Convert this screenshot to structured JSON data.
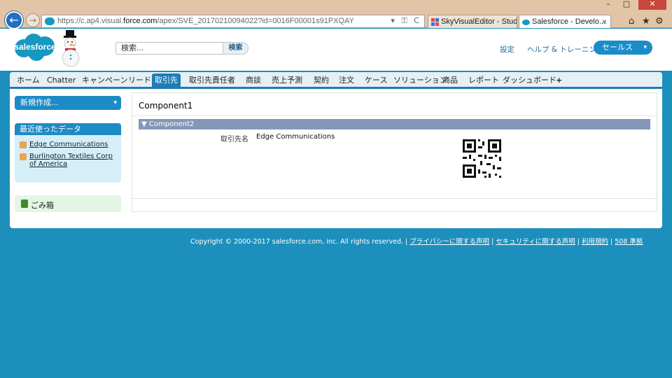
{
  "browser": {
    "url_prefix": "https://c.ap4.visual.",
    "url_domain": "force.com",
    "url_path": "/apex/SVE_20170210094022?id=0016F00001s91PXQAY",
    "address_tools": "▾ ⚿ C",
    "tabs": [
      {
        "label": "SkyVisualEditor - Studio"
      },
      {
        "label": "Salesforce - Develo..."
      }
    ],
    "tab_close": "×",
    "window_controls": {
      "minimize": "–",
      "maximize": "□",
      "close": "✕"
    },
    "toolbar_icons": {
      "home": "⌂",
      "favorites": "★",
      "settings": "⚙"
    },
    "back_glyph": "←",
    "forward_glyph": "→"
  },
  "header": {
    "logo_text": "salesforce",
    "search_placeholder": "検索...",
    "search_button": "検索",
    "links": {
      "settings": "設定",
      "help": "ヘルプ & トレーニング"
    },
    "app_menu": "セールス",
    "caret": "▾"
  },
  "nav": {
    "tabs": [
      "ホーム",
      "Chatter",
      "キャンペーン",
      "リード",
      "取引先",
      "取引先責任者",
      "商談",
      "売上予測",
      "契約",
      "注文",
      "ケース",
      "ソリューション",
      "商品",
      "レポート",
      "ダッシュボード",
      "+"
    ],
    "active": "取引先"
  },
  "sidebar": {
    "create_new": "新規作成...",
    "recent_title": "最近使ったデータ",
    "recent_items": [
      {
        "label": "Edge Communications"
      },
      {
        "label": "Burlington Textiles Corp of America"
      }
    ],
    "trash": "ごみ箱"
  },
  "main": {
    "title": "Component1",
    "section_title": "▼ Component2",
    "field_label": "取引先名",
    "field_value": "Edge Communications"
  },
  "footer": {
    "copyright": "Copyright © 2000-2017 salesforce.com, inc. All rights reserved. | ",
    "links": [
      "プライバシーに関する声明",
      "セキュリティに関する声明",
      "利用規約",
      "508 準拠"
    ],
    "separator": " | "
  },
  "colors": {
    "accent": "#1f7db5",
    "background": "#1d8fbd",
    "section_bar": "#8497b8"
  }
}
